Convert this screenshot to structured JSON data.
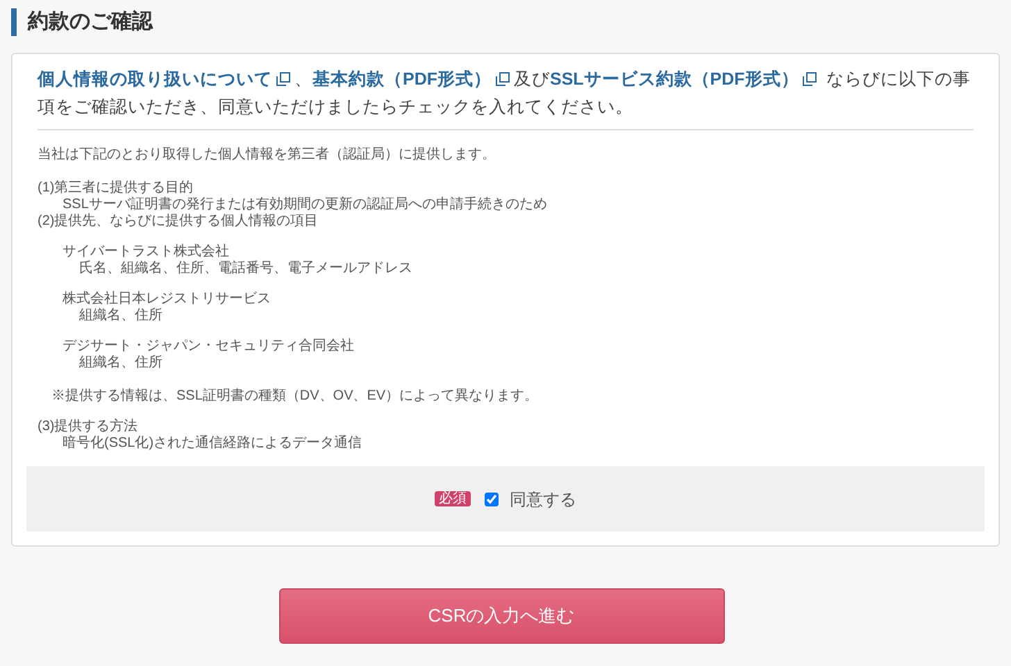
{
  "heading": "約款のご確認",
  "intro": {
    "parts": [
      {
        "kind": "link",
        "text": "個人情報の取り扱いについて"
      },
      {
        "kind": "text",
        "text": "、"
      },
      {
        "kind": "link",
        "text": "基本約款（PDF形式）"
      },
      {
        "kind": "text",
        "text": "及び"
      },
      {
        "kind": "link",
        "text": "SSLサービス約款（PDF形式）"
      },
      {
        "kind": "text",
        "text": " ならびに以下の事項をご確認いただき、同意いただけましたらチェックを入れてください。"
      }
    ]
  },
  "notice": {
    "lead": "当社は下記のとおり取得した個人情報を第三者（認証局）に提供します。",
    "sections": [
      {
        "text": "(1)第三者に提供する目的",
        "children": [
          {
            "text": "SSLサーバ証明書の発行または有効期間の更新の認証局への申請手続きのため"
          }
        ]
      },
      {
        "text": "(2)提供先、ならびに提供する個人情報の項目",
        "children": [
          {
            "kind": "company",
            "text": "サイバートラスト株式会社",
            "children": [
              {
                "text": "氏名、組織名、住所、電話番号、電子メールアドレス"
              }
            ]
          },
          {
            "kind": "company",
            "text": "株式会社日本レジストリサービス",
            "children": [
              {
                "text": "組織名、住所"
              }
            ]
          },
          {
            "kind": "company",
            "text": "デジサート・ジャパン・セキュリティ合同会社",
            "children": [
              {
                "text": "組織名、住所"
              }
            ]
          },
          {
            "kind": "note",
            "text": "※提供する情報は、SSL証明書の種類（DV、OV、EV）によって異なります。"
          }
        ]
      },
      {
        "text": "(3)提供する方法",
        "children": [
          {
            "text": "暗号化(SSL化)された通信経路によるデータ通信"
          }
        ]
      }
    ]
  },
  "agree": {
    "badge": "必須",
    "label": "同意する",
    "checked": true
  },
  "submit": "CSRの入力へ進む"
}
